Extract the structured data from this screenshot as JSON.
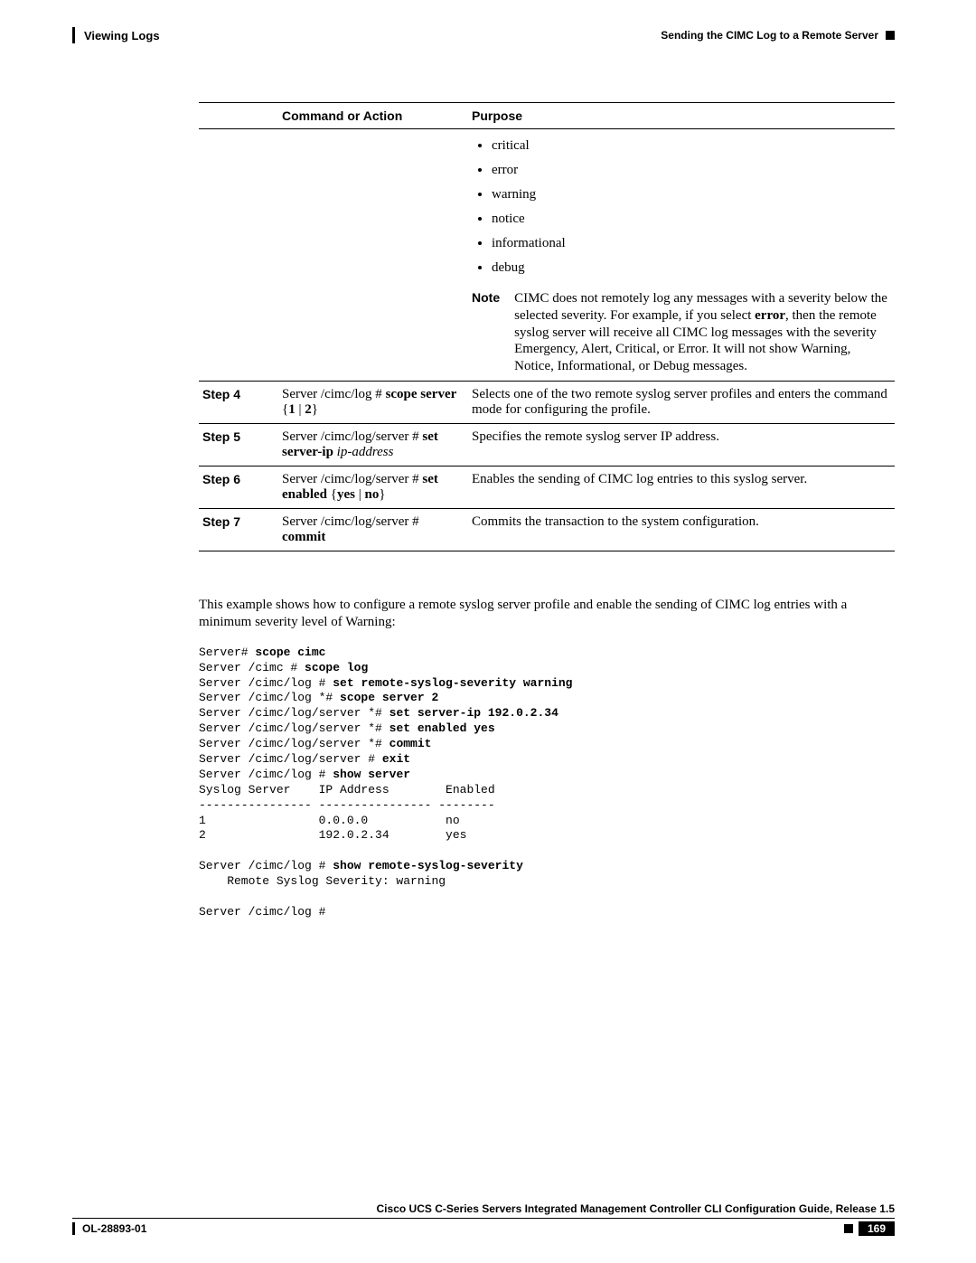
{
  "header": {
    "left": "Viewing Logs",
    "right": "Sending the CIMC Log to a Remote Server"
  },
  "table": {
    "headers": {
      "h1": "",
      "h2": "Command or Action",
      "h3": "Purpose"
    },
    "sevRow": {
      "bullets": [
        "critical",
        "error",
        "warning",
        "notice",
        "informational",
        "debug"
      ],
      "noteLabel": "Note",
      "noteTextPre": "CIMC does not remotely log any messages with a severity below the selected severity. For example, if you select ",
      "noteBold": "error",
      "noteTextPost": ", then the remote syslog server will receive all CIMC log messages with the severity Emergency, Alert, Critical, or Error. It will not show Warning, Notice, Informational, or Debug messages."
    },
    "rows": [
      {
        "step": "Step 4",
        "cmdPre": "Server /cimc/log # ",
        "cmdBold1": "scope server",
        "cmdPost": " {",
        "cmdBold2": "1",
        "cmdMid": " | ",
        "cmdBold3": "2",
        "cmdEnd": "}",
        "purpose": "Selects one of the two remote syslog server profiles and enters the command mode for configuring the profile."
      },
      {
        "step": "Step 5",
        "cmdPre": "Server /cimc/log/server # ",
        "cmdBold1": "set server-ip",
        "cmdItalic": " ip-address",
        "purpose": "Specifies the remote syslog server IP address."
      },
      {
        "step": "Step 6",
        "cmdPre": "Server /cimc/log/server # ",
        "cmdBold1": "set enabled",
        "cmdPost": " {",
        "cmdBold2": "yes",
        "cmdMid": " | ",
        "cmdBold3": "no",
        "cmdEnd": "}",
        "purpose": "Enables the sending of CIMC log entries to this syslog server."
      },
      {
        "step": "Step 7",
        "cmdPre": "Server /cimc/log/server # ",
        "cmdBold1": "commit",
        "purpose": "Commits the transaction to the system configuration."
      }
    ]
  },
  "intro": "This example shows how to configure a remote syslog server profile and enable the sending of CIMC log entries with a minimum severity level of Warning:",
  "example": {
    "l1a": "Server# ",
    "l1b": "scope cimc",
    "l2a": "Server /cimc # ",
    "l2b": "scope log",
    "l3a": "Server /cimc/log # ",
    "l3b": "set remote-syslog-severity warning",
    "l4a": "Server /cimc/log *# ",
    "l4b": "scope server 2",
    "l5a": "Server /cimc/log/server *# ",
    "l5b": "set server-ip 192.0.2.34",
    "l6a": "Server /cimc/log/server *# ",
    "l6b": "set enabled yes",
    "l7a": "Server /cimc/log/server *# ",
    "l7b": "commit",
    "l8a": "Server /cimc/log/server # ",
    "l8b": "exit",
    "l9a": "Server /cimc/log # ",
    "l9b": "show server",
    "l10": "Syslog Server    IP Address        Enabled",
    "l11": "---------------- ---------------- --------",
    "l12": "1                0.0.0.0           no",
    "l13": "2                192.0.2.34        yes",
    "l14": "",
    "l15a": "Server /cimc/log # ",
    "l15b": "show remote-syslog-severity",
    "l16": "    Remote Syslog Severity: warning",
    "l17": "",
    "l18": "Server /cimc/log #"
  },
  "footer": {
    "guide": "Cisco UCS C-Series Servers Integrated Management Controller CLI Configuration Guide, Release 1.5",
    "docid": "OL-28893-01",
    "page": "169"
  }
}
